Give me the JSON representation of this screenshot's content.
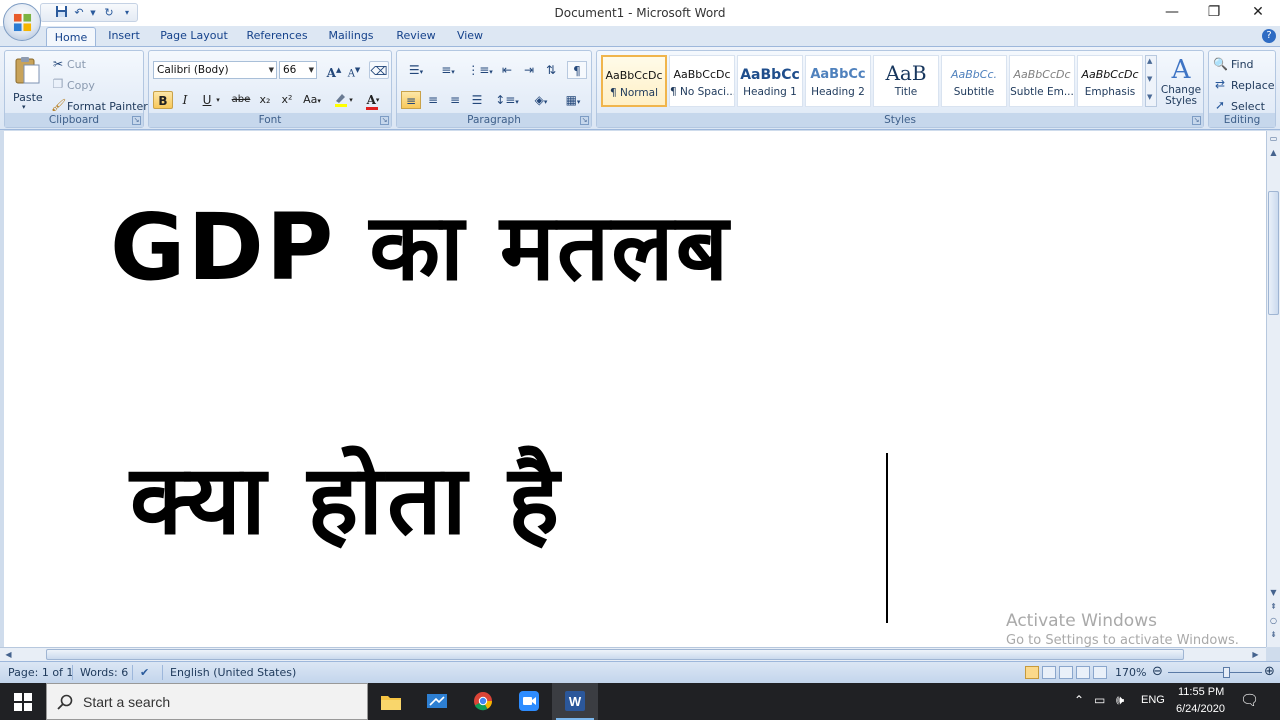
{
  "titlebar": {
    "title": "Document1 - Microsoft Word",
    "minimize": "—",
    "maximize": "❐",
    "close": "✕"
  },
  "tabs": [
    "Home",
    "Insert",
    "Page Layout",
    "References",
    "Mailings",
    "Review",
    "View"
  ],
  "ribbon": {
    "clipboard": {
      "label": "Clipboard",
      "paste": "Paste",
      "cut": "Cut",
      "copy": "Copy",
      "format_painter": "Format Painter"
    },
    "font": {
      "label": "Font",
      "font_name": "Calibri (Body)",
      "font_size": "66",
      "bold": "B",
      "italic": "I",
      "underline": "U",
      "strikethrough": "abe",
      "subscript": "x₂",
      "superscript": "x²",
      "change_case": "Aa",
      "grow": "A",
      "shrink": "A",
      "font_color": "A"
    },
    "paragraph": {
      "label": "Paragraph",
      "pilcrow": "¶"
    },
    "styles": {
      "label": "Styles",
      "items": [
        {
          "preview": "AaBbCcDc",
          "name": "¶ Normal"
        },
        {
          "preview": "AaBbCcDc",
          "name": "¶ No Spaci..."
        },
        {
          "preview": "AaBbCc",
          "name": "Heading 1"
        },
        {
          "preview": "AaBbCc",
          "name": "Heading 2"
        },
        {
          "preview": "AaB",
          "name": "Title"
        },
        {
          "preview": "AaBbCc.",
          "name": "Subtitle"
        },
        {
          "preview": "AaBbCcDc",
          "name": "Subtle Em..."
        },
        {
          "preview": "AaBbCcDc",
          "name": "Emphasis"
        }
      ],
      "change_styles": "Change Styles"
    },
    "editing": {
      "label": "Editing",
      "find": "Find",
      "replace": "Replace",
      "select": "Select"
    }
  },
  "document": {
    "line1": "GDP का  मतलब",
    "line2": "क्या  होता  है"
  },
  "watermark": {
    "title": "Activate Windows",
    "subtitle": "Go to Settings to activate Windows."
  },
  "statusbar": {
    "page": "Page: 1 of 1",
    "words": "Words: 6",
    "language": "English (United States)",
    "zoom": "170%",
    "zoom_level": 0.62
  },
  "taskbar": {
    "search_placeholder": "Start a search",
    "lang": "ENG",
    "time": "11:55 PM",
    "date": "6/24/2020"
  },
  "colors": {
    "accent": "#2b579a",
    "ribbon_bg": "#dbe6f4",
    "selected_style": "#f0b54c"
  }
}
